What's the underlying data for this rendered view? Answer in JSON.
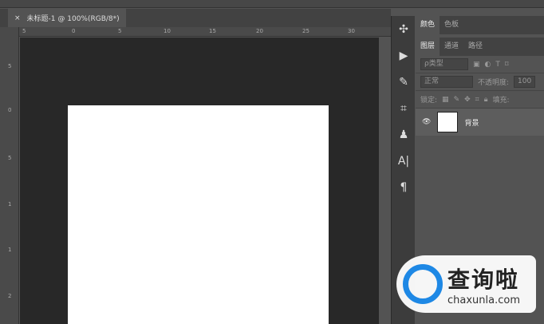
{
  "document_tab": {
    "close": "×",
    "title": "未标题-1 @ 100%(RGB/8*)"
  },
  "ruler": {
    "h_ticks": [
      "5",
      "0",
      "5",
      "10",
      "15",
      "20",
      "25",
      "30"
    ],
    "v_ticks": [
      "5",
      "0",
      "5",
      "1",
      "1",
      "2"
    ]
  },
  "tools": [
    {
      "icon": "puzzle-icon",
      "glyph": "✣"
    },
    {
      "icon": "play-icon",
      "glyph": "▶"
    },
    {
      "icon": "brush-icon",
      "glyph": "✎"
    },
    {
      "icon": "crop-icon",
      "glyph": "⌗"
    },
    {
      "icon": "stamp-icon",
      "glyph": "♟"
    },
    {
      "icon": "character-icon",
      "glyph": "A|"
    },
    {
      "icon": "paragraph-icon",
      "glyph": "¶"
    }
  ],
  "panel": {
    "top_tabs": [
      "颜色",
      "色板"
    ],
    "layer_tabs": [
      "图层",
      "通道",
      "路径"
    ],
    "filter_label": "ρ类型",
    "blend_mode": "正常",
    "opacity_label": "不透明度:",
    "opacity_value": "100",
    "lock_label": "锁定:",
    "fill_label": "填充:",
    "layers": [
      {
        "name": "背景",
        "visible": true
      }
    ]
  },
  "watermark": {
    "cn": "查询啦",
    "en": "chaxunla.com",
    "color": "#1e88e5"
  }
}
